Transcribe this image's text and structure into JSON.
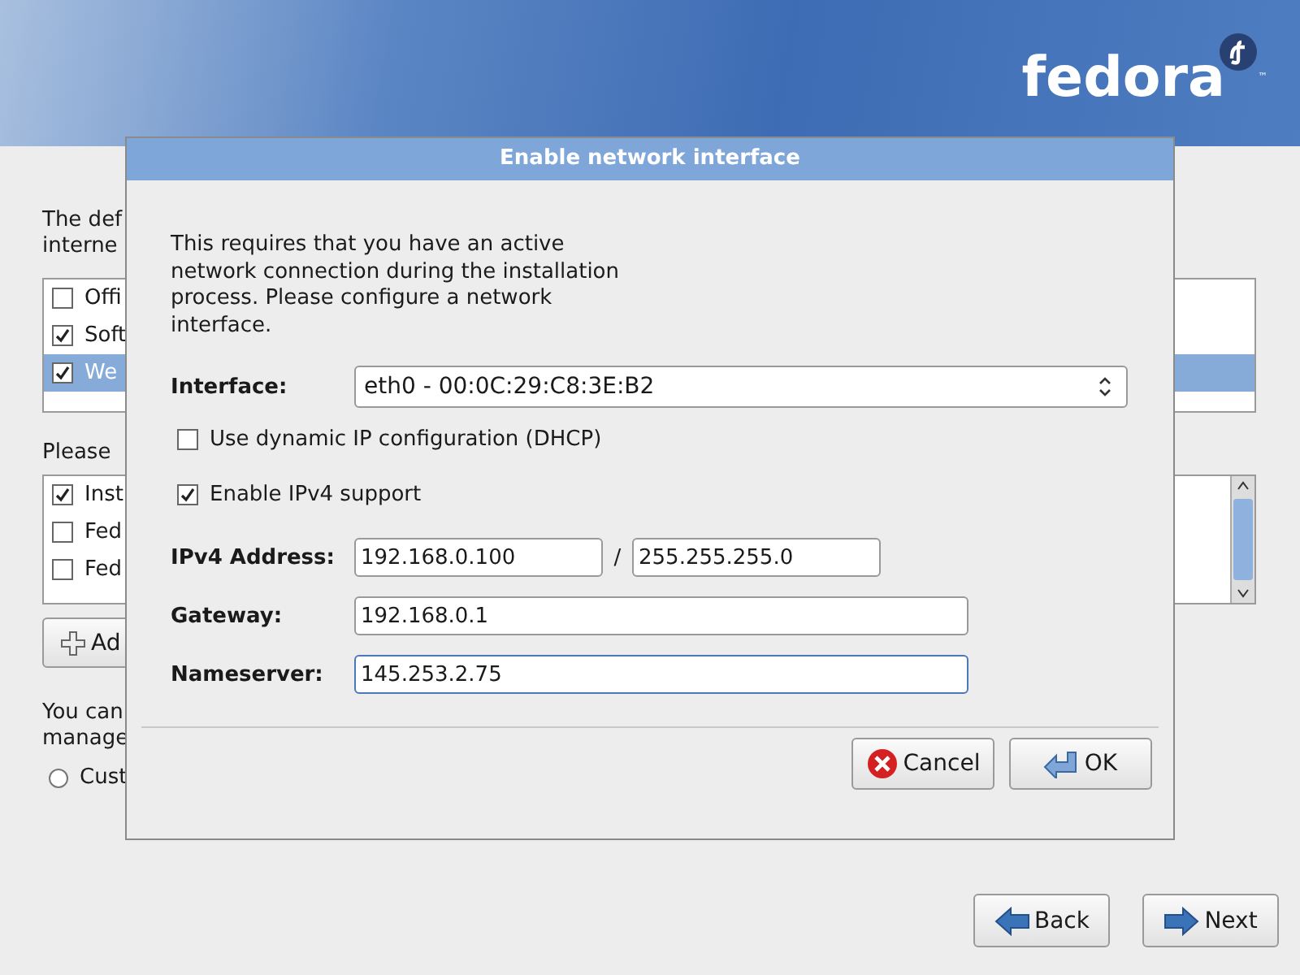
{
  "header": {
    "logo": "fedora",
    "trademark": "™"
  },
  "background": {
    "intro": [
      "The def",
      "interne"
    ],
    "list1": [
      {
        "label": "Offi",
        "checked": false,
        "selected": false
      },
      {
        "label": "Soft",
        "checked": true,
        "selected": false
      },
      {
        "label": "We",
        "checked": true,
        "selected": true
      }
    ],
    "prompt": "Please",
    "list2": [
      {
        "label": "Inst",
        "checked": true
      },
      {
        "label": "Fed",
        "checked": false
      },
      {
        "label": "Fed",
        "checked": false
      }
    ],
    "add_button": "Ad",
    "note": [
      "You can",
      "manage"
    ],
    "radio": {
      "label": "Cust",
      "selected": false
    }
  },
  "dialog": {
    "title": "Enable network interface",
    "description": "This requires that you have an active network connection during the installation process.  Please configure a network interface.",
    "interface": {
      "label": "Interface:",
      "value": "eth0 - 00:0C:29:C8:3E:B2"
    },
    "options": [
      {
        "label": "Use dynamic IP configuration (DHCP)",
        "checked": false
      },
      {
        "label": "Enable IPv4 support",
        "checked": true
      }
    ],
    "ipv4": {
      "label": "IPv4 Address:",
      "address": "192.168.0.100",
      "separator": "/",
      "netmask": "255.255.255.0"
    },
    "fields": [
      {
        "label": "Gateway:",
        "value": "192.168.0.1",
        "focused": false
      },
      {
        "label": "Nameserver:",
        "value": "145.253.2.75",
        "focused": true
      }
    ],
    "buttons": [
      {
        "label": "Cancel",
        "kind": "cancel"
      },
      {
        "label": "OK",
        "kind": "ok"
      }
    ]
  },
  "nav": [
    {
      "label": "Back",
      "kind": "back"
    },
    {
      "label": "Next",
      "kind": "next"
    }
  ]
}
